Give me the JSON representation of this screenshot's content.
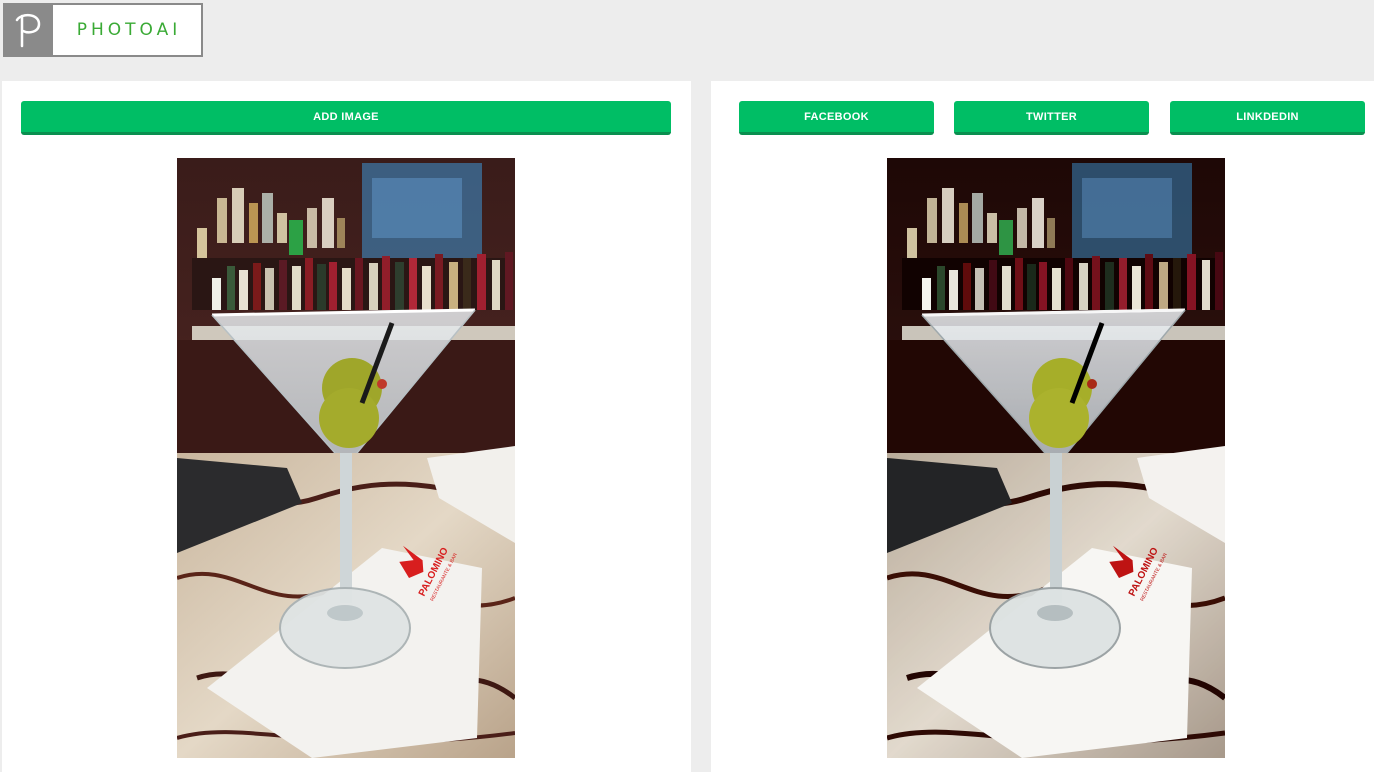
{
  "header": {
    "logo_icon": "p-letter-icon",
    "logo_text": "PHOTOAI",
    "logo_mark": "P"
  },
  "colors": {
    "accent_green": "#00be65",
    "logo_green": "#3aaa35",
    "logo_gray": "#8a8a8a",
    "page_bg": "#ededed"
  },
  "left_panel": {
    "add_image_label": "ADD IMAGE",
    "image_alt": "Original photo: martini glass with olives on a marble bar",
    "napkin_brand": "PALOMINO",
    "napkin_sub": "RESTAURANTE & BAR"
  },
  "right_panel": {
    "share_buttons": [
      {
        "label": "FACEBOOK"
      },
      {
        "label": "TWITTER"
      },
      {
        "label": "LINKDEDIN"
      }
    ],
    "image_alt": "Enhanced photo: martini glass with olives on a marble bar"
  }
}
